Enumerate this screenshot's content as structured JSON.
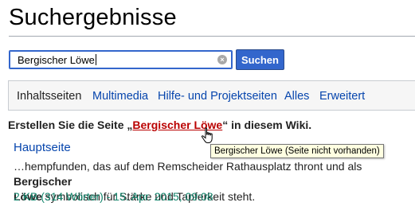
{
  "page": {
    "title": "Suchergebnisse"
  },
  "search": {
    "value": "Bergischer Löwe",
    "button_label": "Suchen"
  },
  "tabs": [
    {
      "label": "Inhaltsseiten",
      "active": true
    },
    {
      "label": "Multimedia",
      "active": false
    },
    {
      "label": "Hilfe- und Projektseiten",
      "active": false
    },
    {
      "label": "Alles",
      "active": false
    },
    {
      "label": "Erweitert",
      "active": false
    }
  ],
  "create": {
    "prefix": "Erstellen Sie die Seite „",
    "link_text": "Bergischer Löwe",
    "suffix": "“ in diesem Wiki."
  },
  "tooltip": "Bergischer Löwe (Seite nicht vorhanden)",
  "results": [
    {
      "title": "Hauptseite",
      "snippet_before": "…hempfunden, das auf dem Remscheider Rathausplatz thront und als ",
      "snippet_match_1": "Bergischer",
      "snippet_match_2": "Löwe",
      "snippet_after": " symbolisch für Stärke und Tapferkeit steht.",
      "meta": "2 KB (314 Wörter) - 15. Apr. 2015, 09:08"
    }
  ],
  "colors": {
    "link": "#0645ad",
    "redlink": "#ba0000",
    "button": "#3366cc",
    "meta": "#14866d"
  }
}
